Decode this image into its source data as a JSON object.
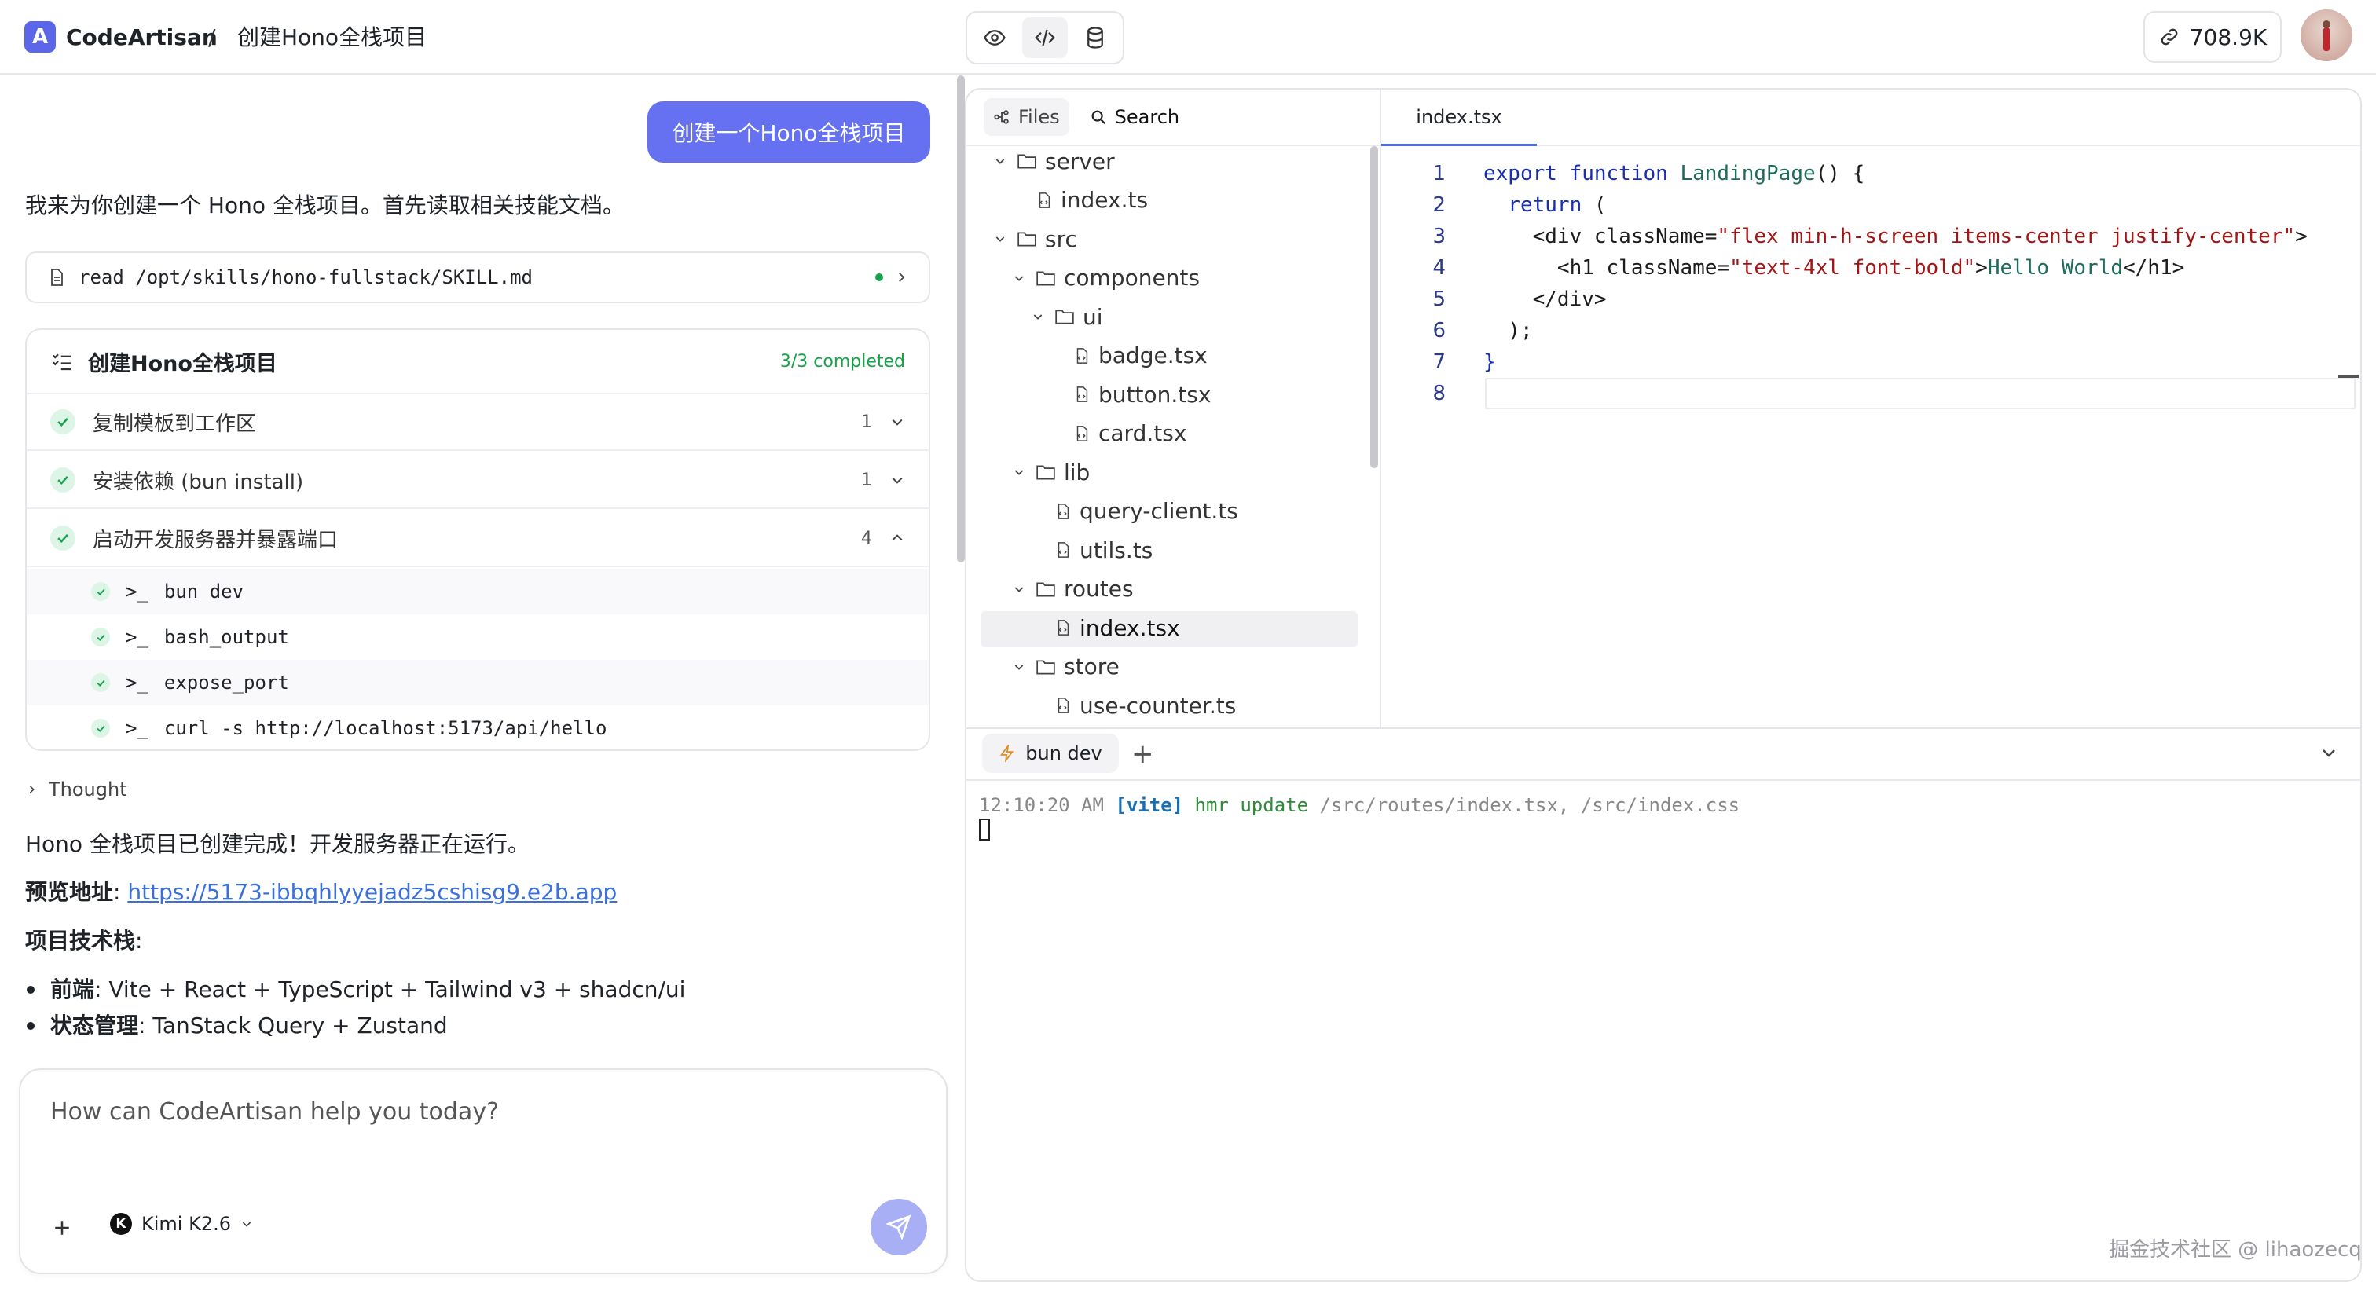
{
  "header": {
    "logo_letter": "A",
    "app_name": "CodeArtisan",
    "breadcrumb_sep": "/",
    "project_title": "创建Hono全栈项目",
    "view_buttons": [
      "preview",
      "code",
      "database"
    ],
    "active_view": "code",
    "token_count": "708.9K"
  },
  "chat": {
    "user_message": "创建一个Hono全栈项目",
    "assistant_intro": "我来为你创建一个 Hono 全栈项目。首先读取相关技能文档。",
    "tool_call": {
      "text": "read /opt/skills/hono-fullstack/SKILL.md",
      "status": "done"
    },
    "task_group": {
      "title": "创建Hono全栈项目",
      "status": "3/3 completed",
      "tasks": [
        {
          "label": "复制模板到工作区",
          "count": "1",
          "expanded": false
        },
        {
          "label": "安装依赖 (bun install)",
          "count": "1",
          "expanded": false
        },
        {
          "label": "启动开发服务器并暴露端口",
          "count": "4",
          "expanded": true
        }
      ],
      "steps": [
        {
          "prompt": ">_",
          "cmd": "bun dev"
        },
        {
          "prompt": ">_",
          "cmd": "bash_output"
        },
        {
          "prompt": ">_",
          "cmd": "expose_port"
        },
        {
          "prompt": ">_",
          "cmd": "curl -s http://localhost:5173/api/hello"
        }
      ]
    },
    "thought_label": "Thought",
    "done_message": "Hono 全栈项目已创建完成！开发服务器正在运行。",
    "preview_label": "预览地址",
    "preview_url": "https://5173-ibbqhlyyejadz5cshisg9.e2b.app",
    "stack_label": "项目技术栈",
    "stack": [
      {
        "label": "前端",
        "value": "Vite + React + TypeScript + Tailwind v3 + shadcn/ui"
      },
      {
        "label": "状态管理",
        "value": "TanStack Query + Zustand"
      }
    ],
    "colon": ":"
  },
  "composer": {
    "placeholder": "How can CodeArtisan help you today?",
    "model": "Kimi K2.6",
    "model_icon_letter": "K"
  },
  "explorer": {
    "tab_files": "Files",
    "tab_search": "Search",
    "active_tab": "Files",
    "tree": [
      {
        "name": "server",
        "type": "folder",
        "depth": 0,
        "open": true
      },
      {
        "name": "index.ts",
        "type": "file",
        "depth": 1
      },
      {
        "name": "src",
        "type": "folder",
        "depth": 0,
        "open": true
      },
      {
        "name": "components",
        "type": "folder",
        "depth": 1,
        "open": true
      },
      {
        "name": "ui",
        "type": "folder",
        "depth": 2,
        "open": true
      },
      {
        "name": "badge.tsx",
        "type": "file",
        "depth": 3
      },
      {
        "name": "button.tsx",
        "type": "file",
        "depth": 3
      },
      {
        "name": "card.tsx",
        "type": "file",
        "depth": 3
      },
      {
        "name": "lib",
        "type": "folder",
        "depth": 1,
        "open": true
      },
      {
        "name": "query-client.ts",
        "type": "file",
        "depth": 2
      },
      {
        "name": "utils.ts",
        "type": "file",
        "depth": 2
      },
      {
        "name": "routes",
        "type": "folder",
        "depth": 1,
        "open": true
      },
      {
        "name": "index.tsx",
        "type": "file",
        "depth": 2,
        "selected": true
      },
      {
        "name": "store",
        "type": "folder",
        "depth": 1,
        "open": true
      },
      {
        "name": "use-counter.ts",
        "type": "file",
        "depth": 2
      }
    ]
  },
  "editor": {
    "tab": "index.tsx",
    "line_numbers": [
      "1",
      "2",
      "3",
      "4",
      "5",
      "6",
      "7",
      "8"
    ],
    "lines": [
      [
        {
          "t": "export function ",
          "c": "kw"
        },
        {
          "t": "LandingPage",
          "c": "fn"
        },
        {
          "t": "() {",
          "c": "pl"
        }
      ],
      [
        {
          "t": "  return ",
          "c": "kw"
        },
        {
          "t": "(",
          "c": "pl"
        }
      ],
      [
        {
          "t": "    <div className=",
          "c": "pl"
        },
        {
          "t": "\"flex min-h-screen items-center justify-center\"",
          "c": "str"
        },
        {
          "t": ">",
          "c": "pl"
        }
      ],
      [
        {
          "t": "      <h1 className=",
          "c": "pl"
        },
        {
          "t": "\"text-4xl font-bold\"",
          "c": "str"
        },
        {
          "t": ">",
          "c": "pl"
        },
        {
          "t": "Hello World",
          "c": "txt"
        },
        {
          "t": "</h1>",
          "c": "pl"
        }
      ],
      [
        {
          "t": "    </div>",
          "c": "pl"
        }
      ],
      [
        {
          "t": "  );",
          "c": "pl"
        }
      ],
      [
        {
          "t": "}",
          "c": "kw"
        }
      ],
      [
        {
          "t": "",
          "c": "pl"
        }
      ]
    ],
    "colors": {
      "kw": "#1a2fb0",
      "fn": "#1f6b5c",
      "str": "#a31515",
      "txt": "#1f6b5c",
      "pl": "#1c1c1c"
    }
  },
  "terminal": {
    "tab": "bun dev",
    "add_label": "+",
    "line": {
      "time": "12:10:20 AM ",
      "tag": "[vite]",
      "event": " hmr update ",
      "paths": "/src/routes/index.tsx, /src/index.css"
    }
  },
  "watermark": "掘金技术社区 @ lihaozecq",
  "colors": {
    "accent": "#6571f0",
    "success": "#16a34a",
    "link": "#3b6fdc",
    "tab_underline": "#4a6cf0"
  }
}
